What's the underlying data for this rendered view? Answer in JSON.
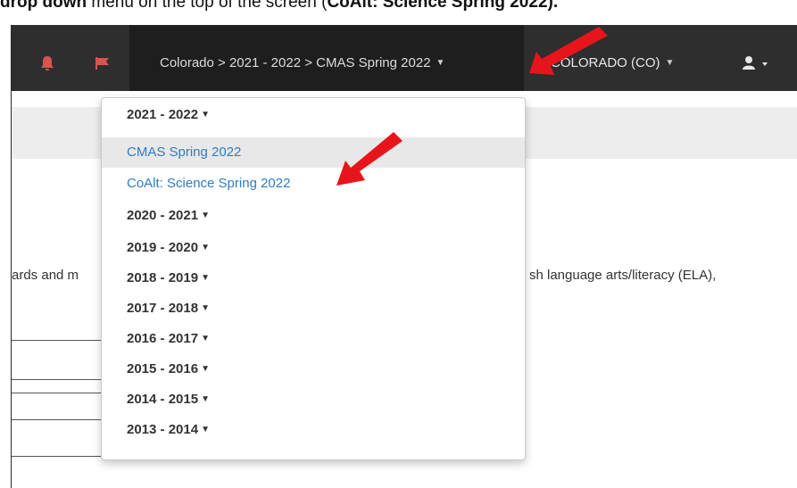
{
  "caption": {
    "prefix": "drop down",
    "middle": " menu on the top of the screen (",
    "highlight": "CoAlt: Science Spring 2022",
    "suffix": ")."
  },
  "navbar": {
    "breadcrumb": "Colorado > 2021 - 2022 > CMAS Spring 2022",
    "state": "COLORADO (CO)",
    "icons": [
      "bell-icon",
      "flag-icon",
      "user-icon"
    ],
    "colors": {
      "background": "#2e2e2e",
      "alert": "#d9534f",
      "link": "#2f7cc2"
    }
  },
  "page": {
    "text_left": "ards and m",
    "text_right": "sh language arts/literacy (ELA),"
  },
  "menu": {
    "items": [
      {
        "label": "2021 - 2022",
        "kind": "year"
      },
      {
        "label": "CMAS Spring 2022",
        "kind": "link",
        "active": true
      },
      {
        "label": "CoAlt: Science Spring 2022",
        "kind": "link"
      },
      {
        "label": "2020 - 2021",
        "kind": "year"
      },
      {
        "label": "2019 - 2020",
        "kind": "year"
      },
      {
        "label": "2018 - 2019",
        "kind": "year"
      },
      {
        "label": "2017 - 2018",
        "kind": "year"
      },
      {
        "label": "2016 - 2017",
        "kind": "year"
      },
      {
        "label": "2015 - 2016",
        "kind": "year"
      },
      {
        "label": "2014 - 2015",
        "kind": "year"
      },
      {
        "label": "2013 - 2014",
        "kind": "year"
      }
    ]
  }
}
